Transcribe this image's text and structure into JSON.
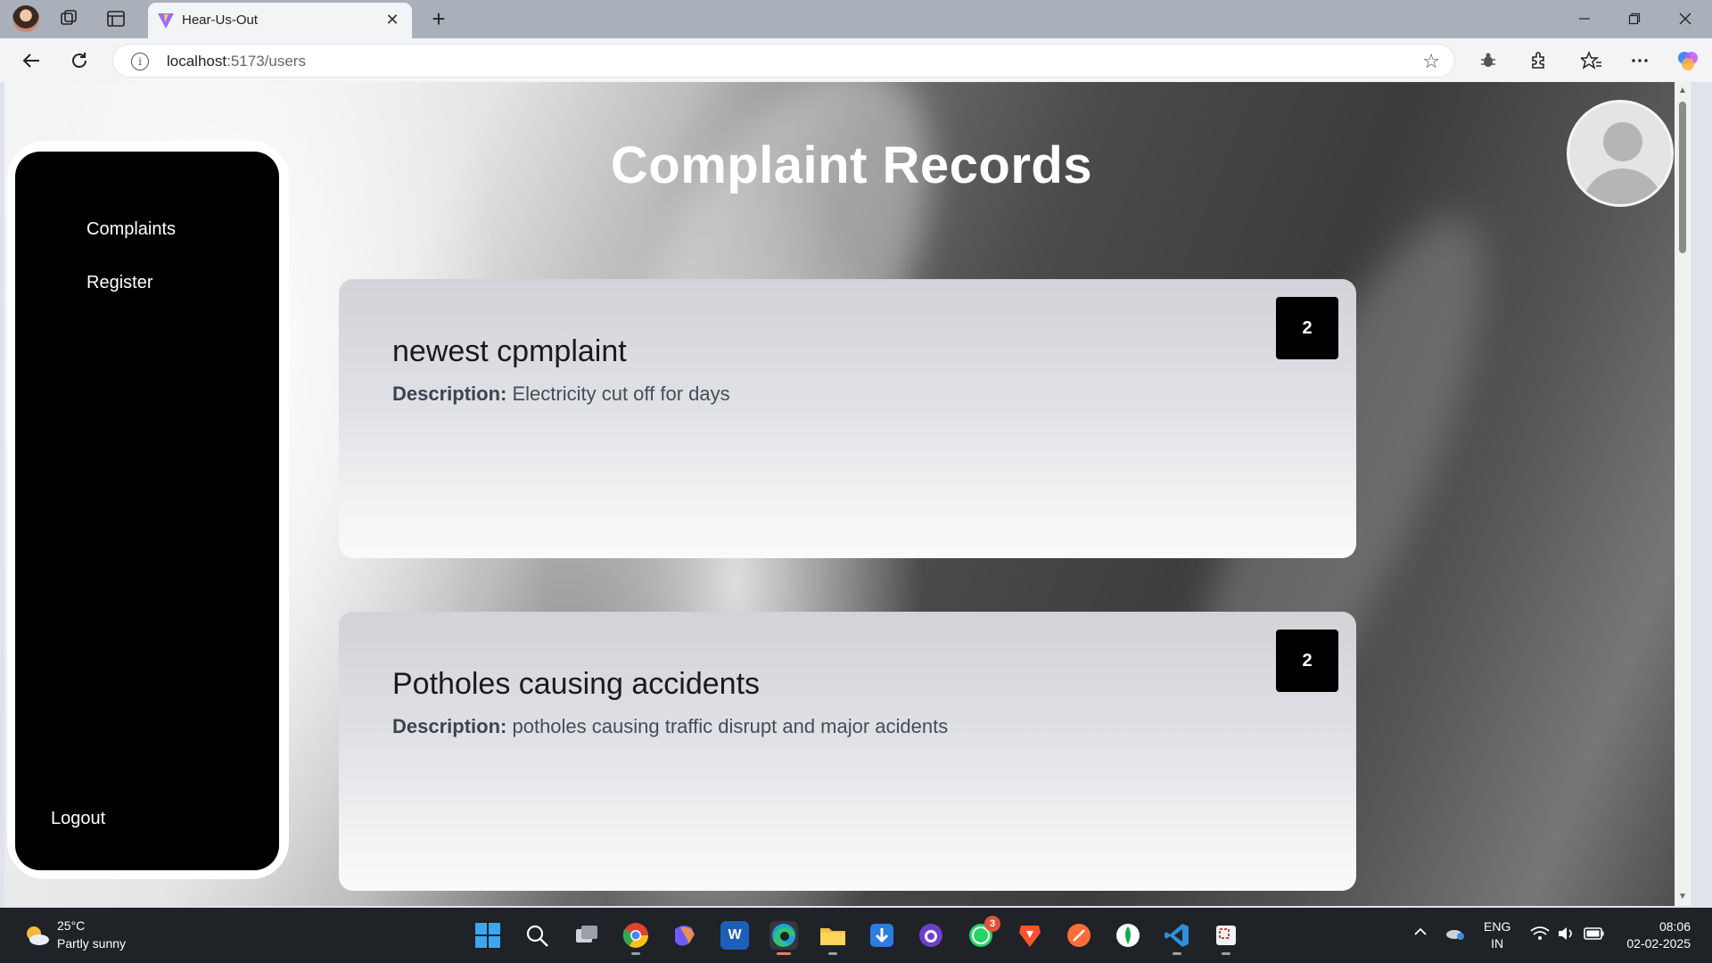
{
  "browser": {
    "tab_title": "Hear-Us-Out",
    "url_host": "localhost",
    "url_rest": ":5173/users",
    "new_tab_symbol": "+",
    "close_tab_symbol": "✕"
  },
  "sidebar": {
    "items": [
      {
        "label": "Complaints"
      },
      {
        "label": "Register"
      }
    ],
    "logout_label": "Logout"
  },
  "main": {
    "title": "Complaint Records",
    "complaints": [
      {
        "title": "newest cpmplaint",
        "description_label": "Description:",
        "description": "Electricity cut off for days",
        "count": "2"
      },
      {
        "title": "Potholes causing accidents",
        "description_label": "Description:",
        "description": "potholes causing traffic disrupt and major acidents",
        "count": "2"
      }
    ]
  },
  "taskbar": {
    "weather_temp": "25°C",
    "weather_desc": "Partly sunny",
    "whatsapp_badge": "3",
    "lang_primary": "ENG",
    "lang_secondary": "IN",
    "time": "08:06",
    "date": "02-02-2025",
    "apps": [
      "start-icon",
      "search-icon",
      "task-view-icon",
      "chrome-icon",
      "copilot-icon",
      "word-icon",
      "edge-icon",
      "file-explorer-icon",
      "downloader-icon",
      "github-icon",
      "whatsapp-icon",
      "brave-icon",
      "postman-icon",
      "mongodb-icon",
      "vscode-icon",
      "snipping-tool-icon"
    ]
  },
  "colors": {
    "sidebar_bg": "#000000",
    "badge_bg": "#000000",
    "title_color": "#ffffff",
    "tabbar_bg": "#a9b0ba",
    "taskbar_bg": "#1f2226"
  }
}
